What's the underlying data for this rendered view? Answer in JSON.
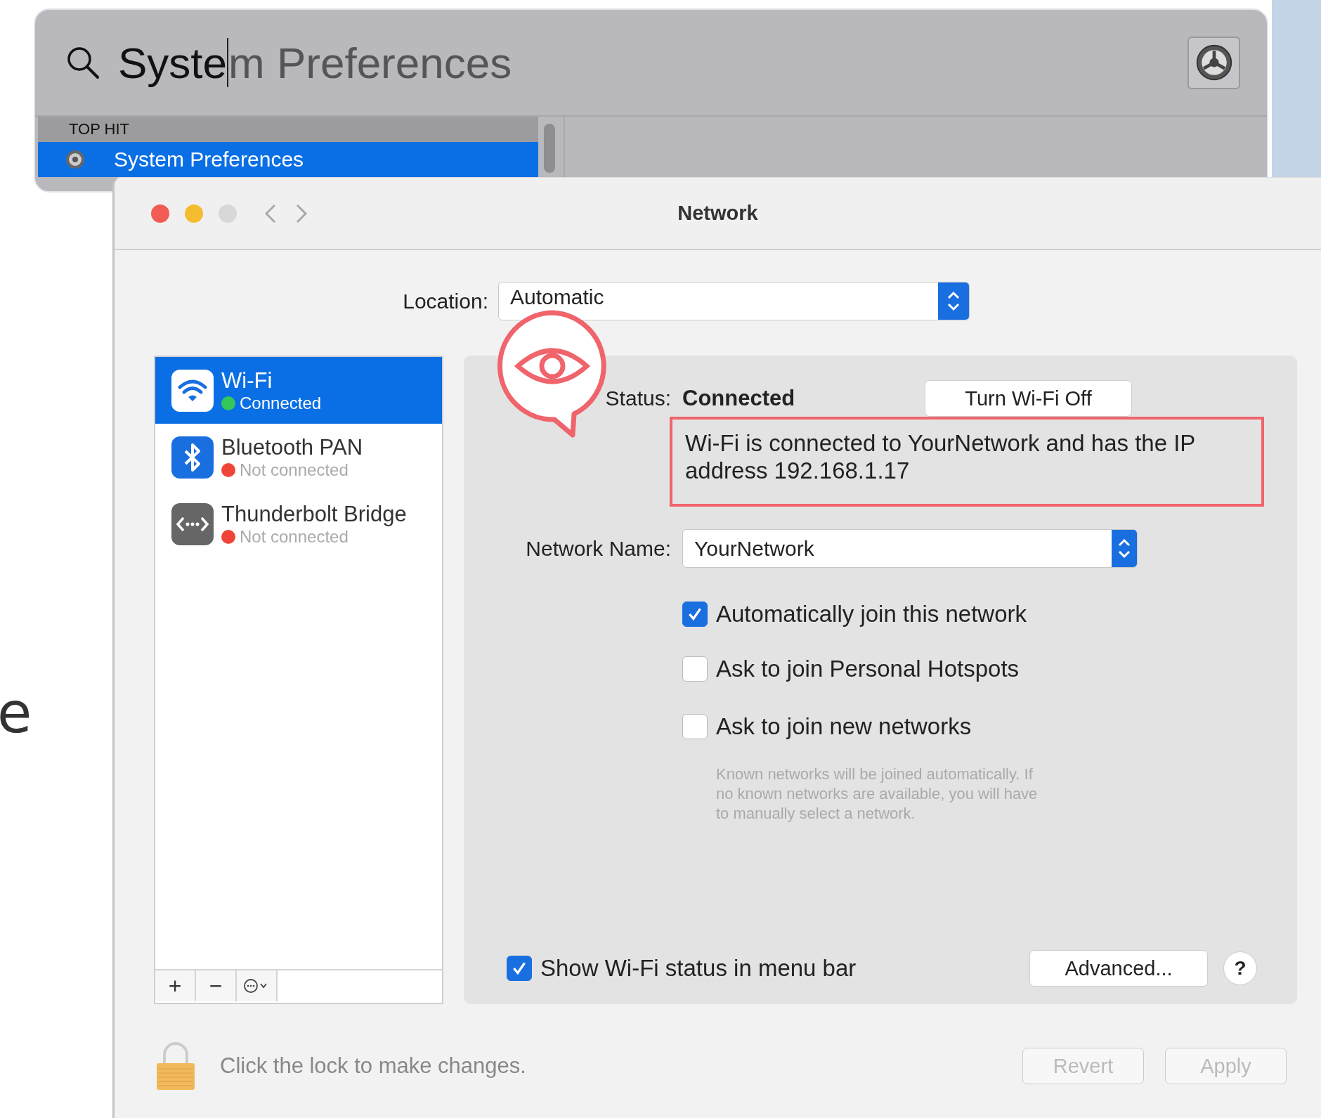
{
  "background_text": "e",
  "spotlight": {
    "typed": "Syste",
    "completion": "m Preferences",
    "section_header": "TOP HIT",
    "top_hit": {
      "label": "System Preferences",
      "selected": true
    }
  },
  "window": {
    "title": "Network"
  },
  "location": {
    "label": "Location:",
    "value": "Automatic"
  },
  "services": [
    {
      "name": "Wi-Fi",
      "status": "Connected",
      "color": "#34c759",
      "selected": true,
      "kind": "wifi"
    },
    {
      "name": "Bluetooth PAN",
      "status": "Not connected",
      "color": "#f04438",
      "selected": false,
      "kind": "bluetooth"
    },
    {
      "name": "Thunderbolt Bridge",
      "status": "Not connected",
      "color": "#f04438",
      "selected": false,
      "kind": "bridge"
    }
  ],
  "list_toolbar": [
    "+",
    "−"
  ],
  "status": {
    "label": "Status:",
    "value": "Connected",
    "button": "Turn Wi-Fi Off",
    "description": "Wi-Fi is connected to YourNetwork and has the IP address 192.168.1.17",
    "highlighted": true
  },
  "network_name": {
    "label": "Network Name:",
    "value": "YourNetwork"
  },
  "options": [
    {
      "label": "Automatically join this network",
      "checked": true
    },
    {
      "label": "Ask to join Personal Hotspots",
      "checked": false
    },
    {
      "label": "Ask to join new networks",
      "checked": false
    }
  ],
  "hint": "Known networks will be joined automatically. If no known networks are available, you will have to manually select a network.",
  "show_status": {
    "label": "Show Wi-Fi status in menu bar",
    "checked": true
  },
  "advanced_button": "Advanced...",
  "help_button": "?",
  "lock_text": "Click the lock to make changes.",
  "buttons": [
    {
      "label": "Revert",
      "disabled": true
    },
    {
      "label": "Apply",
      "disabled": true
    }
  ]
}
